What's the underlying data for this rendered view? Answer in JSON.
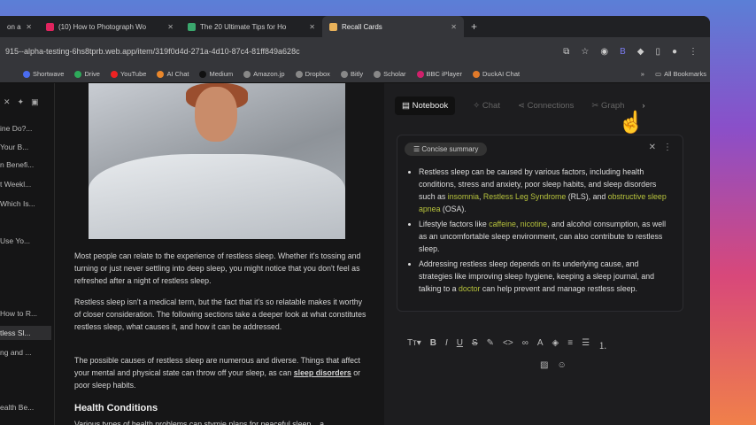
{
  "browser": {
    "tabs": [
      {
        "label": "on a",
        "active": false
      },
      {
        "label": "(10) How to Photograph Wo",
        "active": false
      },
      {
        "label": "The 20 Ultimate Tips for Ho",
        "active": false
      },
      {
        "label": "Recall Cards",
        "active": true
      }
    ],
    "new_tab": "+",
    "url": "915--alpha-testing-6hs8tprb.web.app/item/319f0d4d-271a-4d10-87c4-81ff849a628c",
    "bookmarks": [
      "Shortwave",
      "Drive",
      "YouTube",
      "AI Chat",
      "Medium",
      "Amazon.jp",
      "Dropbox",
      "Bitly",
      "Scholar",
      "BBC iPlayer",
      "DuckAI Chat"
    ],
    "bookmarks_more": "»",
    "all_bookmarks": "All Bookmarks"
  },
  "sidebar": {
    "items": [
      "ine Do?...",
      "Your B...",
      "n Benefi...",
      "t Weekl...",
      "Which Is...",
      "Use Yo...",
      "How to R...",
      "tless Sl...",
      "ng and ...",
      "ealth Be..."
    ],
    "selected": 7
  },
  "article": {
    "paragraphs": [
      "Most people can relate to the experience of restless sleep. Whether it's tossing and turning or just never settling into deep sleep, you might notice that you don't feel as refreshed after a night of restless sleep.",
      "Restless sleep isn't a medical term, but the fact that it's so relatable makes it worthy of closer consideration. The following sections take a deeper look at what constitutes restless sleep, what causes it, and how it can be addressed."
    ],
    "p3_before": "The possible causes of restless sleep are numerous and diverse. Things that affect your mental and physical state can throw off your sleep, as can ",
    "p3_link": "sleep disorders",
    "p3_after": " or poor sleep habits.",
    "heading": "Health Conditions",
    "p4": "Various types of health problems can stymie plans for peaceful sleep... a"
  },
  "panel": {
    "tabs": [
      "Notebook",
      "Chat",
      "Connections",
      "Graph"
    ],
    "summary_chip": "Concise summary",
    "bullets": [
      [
        {
          "t": "Restless sleep can be caused by various factors, including health conditions, stress and anxiety, poor sleep habits, and sleep disorders such as "
        },
        {
          "t": "insomnia",
          "h": true
        },
        {
          "t": ", "
        },
        {
          "t": "Restless Leg Syndrome",
          "h": true
        },
        {
          "t": " (RLS), and "
        },
        {
          "t": "obstructive sleep apnea",
          "h": true
        },
        {
          "t": " (OSA)."
        }
      ],
      [
        {
          "t": "Lifestyle factors like "
        },
        {
          "t": "caffeine",
          "h": true
        },
        {
          "t": ", "
        },
        {
          "t": "nicotine",
          "h": true
        },
        {
          "t": ", and alcohol consumption, as well as an uncomfortable sleep environment, can also contribute to restless sleep."
        }
      ],
      [
        {
          "t": "Addressing restless sleep depends on its underlying cause, and strategies like improving sleep hygiene, keeping a sleep journal, and talking to a "
        },
        {
          "t": "doctor",
          "h": true
        },
        {
          "t": " can help prevent and manage restless sleep."
        }
      ]
    ],
    "highlight_color": "#b7c33c"
  }
}
